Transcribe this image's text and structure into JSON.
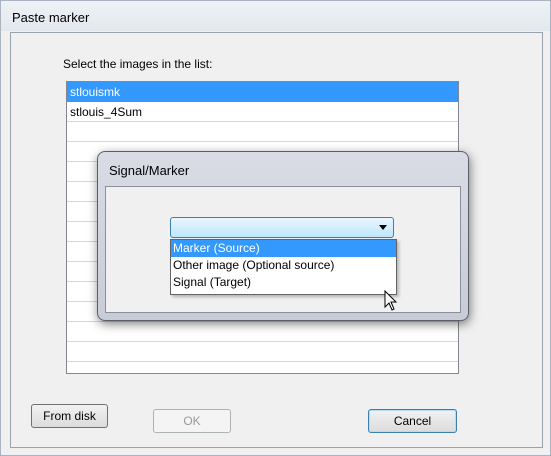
{
  "window": {
    "title": "Paste marker"
  },
  "prompt": "Select the images in the list:",
  "image_list": {
    "items": [
      {
        "label": "stlouismk",
        "selected": true
      },
      {
        "label": "stlouis_4Sum",
        "selected": false
      }
    ]
  },
  "buttons": {
    "from_disk": "From disk",
    "ok": "OK",
    "cancel": "Cancel"
  },
  "modal": {
    "title": "Signal/Marker",
    "combo_value": "",
    "options": [
      "Marker (Source)",
      "Other image (Optional source)",
      "Signal (Target)"
    ],
    "highlighted_index": 0
  },
  "colors": {
    "selection": "#3399ff",
    "window_bg": "#f0f0f0"
  }
}
